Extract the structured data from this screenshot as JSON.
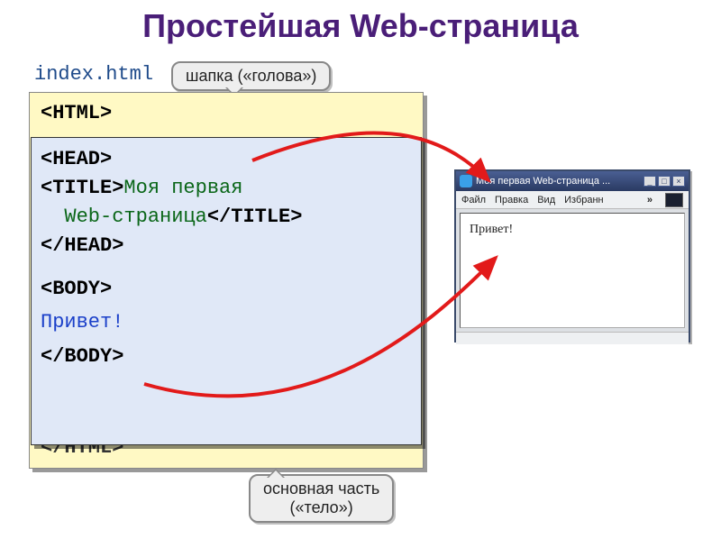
{
  "title": "Простейшая Web-страница",
  "filename": "index.html",
  "callouts": {
    "head": "шапка («голова»)",
    "body_line1": "основная часть",
    "body_line2": "(«тело»)"
  },
  "code": {
    "html_open": "<HTML>",
    "html_close": "</HTML>",
    "head_open": "<HEAD>",
    "title_open": "<TITLE>",
    "title_text_1": "Моя первая",
    "title_text_2": "Web-страница",
    "title_close": "</TITLE>",
    "head_close": "</HEAD>",
    "body_open": "<BODY>",
    "body_text": "Привет!",
    "body_close": "</BODY>"
  },
  "browser": {
    "title": "Моя первая Web-страница ...",
    "menu": {
      "file": "Файл",
      "edit": "Правка",
      "view": "Вид",
      "favorites": "Избранн",
      "chev": "»"
    },
    "content": "Привет!"
  }
}
